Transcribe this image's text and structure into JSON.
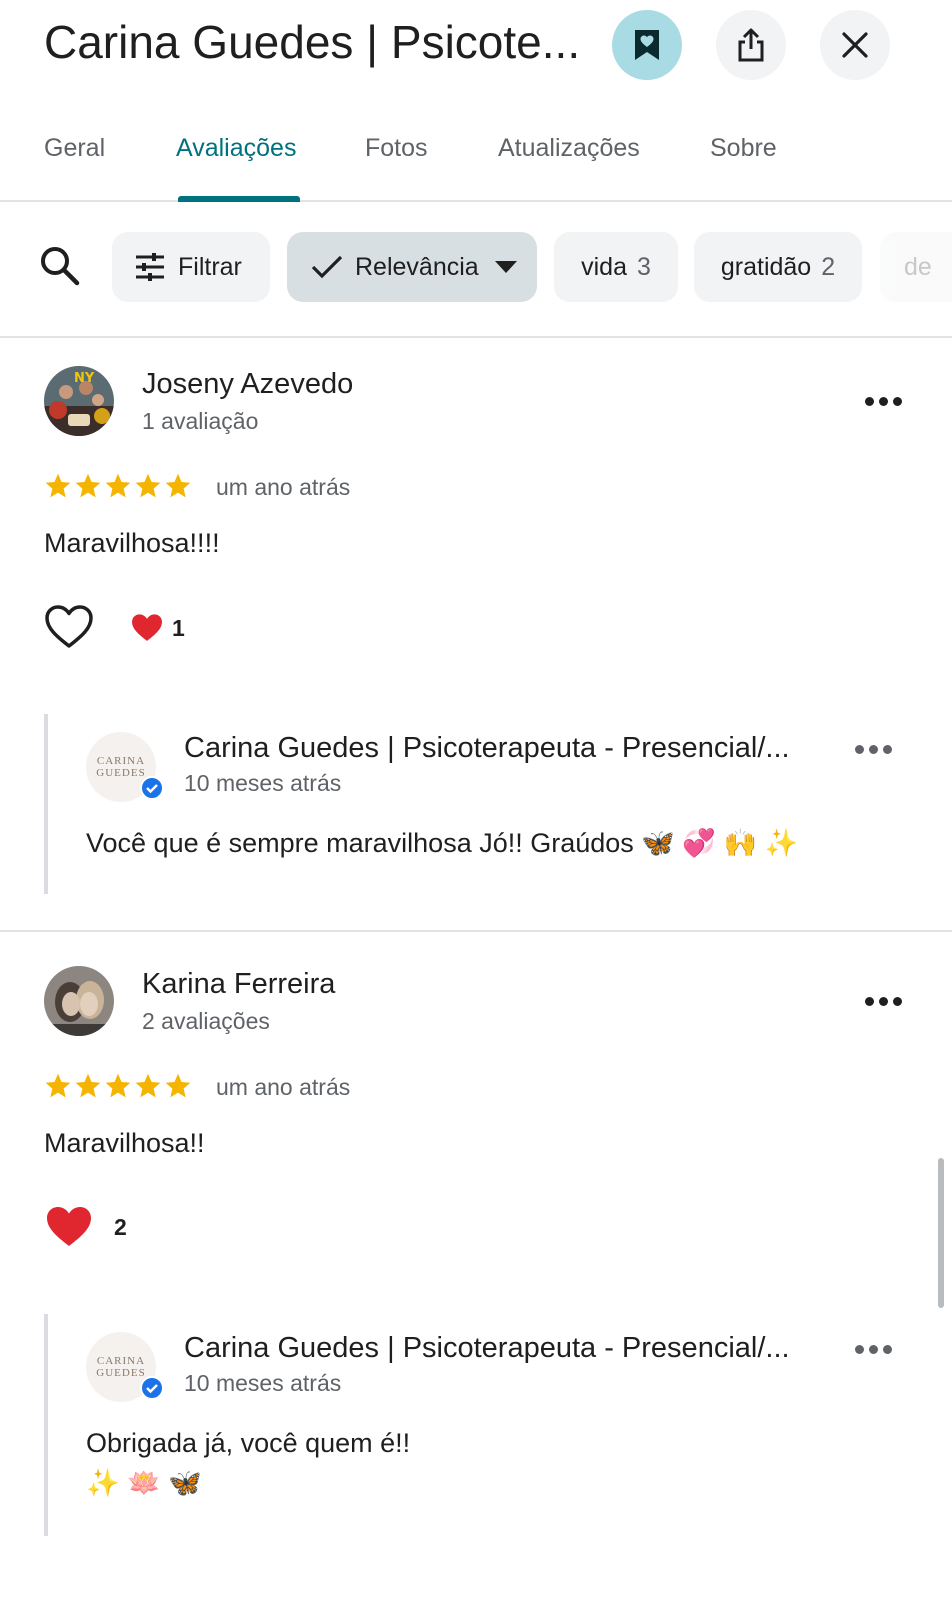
{
  "header": {
    "title": "Carina Guedes | Psicote...",
    "icons": {
      "save": "bookmark-heart-icon",
      "share": "share-icon",
      "close": "close-icon"
    },
    "accent_color": "#00727f",
    "saved_bg_color": "#a8dbe4"
  },
  "tabs": [
    {
      "label": "Geral",
      "active": false
    },
    {
      "label": "Avaliações",
      "active": true
    },
    {
      "label": "Fotos",
      "active": false
    },
    {
      "label": "Atualizações",
      "active": false
    },
    {
      "label": "Sobre",
      "active": false
    }
  ],
  "filters": {
    "search_icon": "search-icon",
    "filter_label": "Filtrar",
    "sort_label": "Relevância",
    "chips": [
      {
        "label": "vida",
        "count": "3"
      },
      {
        "label": "gratidão",
        "count": "2"
      },
      {
        "label": "de",
        "count": ""
      }
    ]
  },
  "reviews": [
    {
      "author": "Joseny Azevedo",
      "review_count": "1 avaliação",
      "rating": 5,
      "date": "um ano atrás",
      "text": "Maravilhosa!!!!",
      "reactions_count": "1",
      "owner_reply": {
        "name": "Carina Guedes | Psicoterapeuta - Presencial/...",
        "date": "10 meses atrás",
        "lines": [
          "Você que é sempre maravilhosa Jó!! Graúdos 🦋 💞 🙌 ✨"
        ]
      }
    },
    {
      "author": "Karina Ferreira",
      "review_count": "2 avaliações",
      "rating": 5,
      "date": "um ano atrás",
      "text": "Maravilhosa!!",
      "reactions_count": "2",
      "owner_reply": {
        "name": "Carina Guedes | Psicoterapeuta - Presencial/...",
        "date": "10 meses atrás",
        "lines": [
          "Obrigada já, você quem é!!",
          "✨ 🪷 🦋"
        ]
      }
    }
  ],
  "owner_logo": {
    "line1": "CARINA",
    "line2": "GUEDES"
  },
  "star_color": "#f4b400",
  "verified_color": "#1a73e8"
}
